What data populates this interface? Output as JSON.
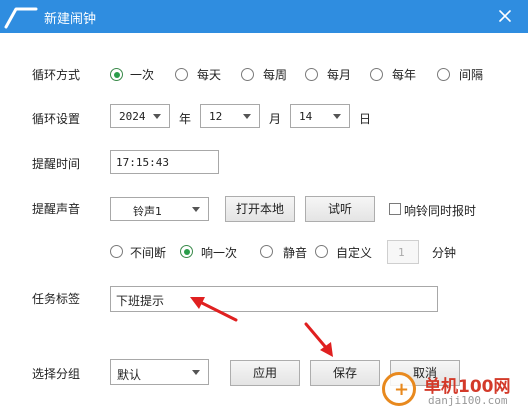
{
  "window": {
    "title": "新建闹钟"
  },
  "loop_mode": {
    "label": "循环方式",
    "options": [
      "一次",
      "每天",
      "每周",
      "每月",
      "每年",
      "间隔"
    ],
    "selected": "一次"
  },
  "loop_settings": {
    "label": "循环设置",
    "year": "2024",
    "year_unit": "年",
    "month": "12",
    "month_unit": "月",
    "day": "14",
    "day_unit": "日"
  },
  "reminder_time": {
    "label": "提醒时间",
    "value": "17:15:43"
  },
  "reminder_sound": {
    "label": "提醒声音",
    "sound": "铃声1",
    "open_local_label": "打开本地",
    "preview_label": "试听",
    "sync_label": "响铃同时报时",
    "sync_checked": false,
    "modes": [
      "不间断",
      "响一次",
      "静音",
      "自定义"
    ],
    "selected_mode": "响一次",
    "custom_value_placeholder": "1",
    "minute_unit": "分钟"
  },
  "task_label": {
    "label": "任务标签",
    "value": "下班提示"
  },
  "group": {
    "label": "选择分组",
    "value": "默认",
    "apply_label": "应用",
    "save_label": "保存",
    "cancel_label": "取消"
  },
  "watermark": {
    "brand": "单机100网",
    "url": "danji100.com"
  },
  "colors": {
    "titlebar": "#2f8de0",
    "radio_selected": "#2a9d4a",
    "annotation_arrow": "#e02020"
  }
}
